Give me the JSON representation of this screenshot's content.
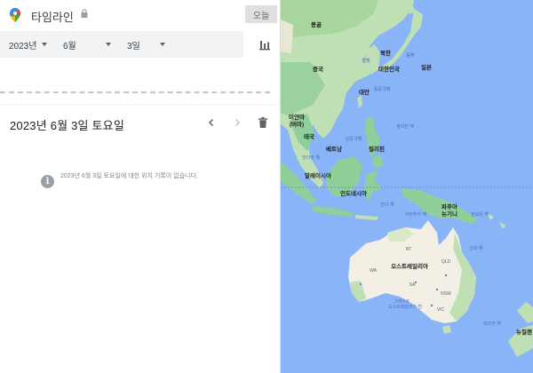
{
  "header": {
    "title": "타임라인",
    "today_label": "오늘"
  },
  "filters": {
    "year": "2023년",
    "month": "6월",
    "day": "3일"
  },
  "day_view": {
    "date_title": "2023년 6월 3일 토요일",
    "empty_message": "2023년 6월 3일 토요일에 대한 위치 기록이 없습니다."
  },
  "map": {
    "country_labels": {
      "mongolia": "몽골",
      "china": "중국",
      "north_korea": "북한",
      "south_korea": "대한민국",
      "japan": "일본",
      "taiwan": "대만",
      "myanmar_1": "미얀마",
      "myanmar_2": "(버마)",
      "thailand": "태국",
      "vietnam": "베트남",
      "philippines": "필리핀",
      "malaysia": "말레이시아",
      "indonesia": "인도네시아",
      "png_1": "파푸아",
      "png_2": "뉴기니",
      "australia": "오스트레일리아",
      "new_zealand": "뉴질랜",
      "wa": "WA",
      "nt": "NT",
      "sa": "SA",
      "qld": "QLD",
      "nsw": "NSW",
      "vic": "VIC"
    },
    "sea_labels": {
      "east_sea": "동해",
      "east_china_sea": "동중국해",
      "south_china_sea": "남중국해",
      "philippine_sea": "필리핀 해",
      "andaman_sea": "안다만 해",
      "banda_sea": "반다 해",
      "arafura_sea": "아라푸라 해",
      "solomon_sea": "솔로몬 해",
      "coral_sea": "산호 해",
      "great_bight_1": "그레이트",
      "great_bight_2": "오스트레일리아 만",
      "tasman_sea": "태즈먼 해",
      "yellow_sea": "황해"
    },
    "colors": {
      "ocean": "#8ab4f8",
      "land": "#bfe0b4",
      "forest": "#8fcf9a",
      "desert": "#f3efe4",
      "equator": "#6f7fb8"
    }
  }
}
